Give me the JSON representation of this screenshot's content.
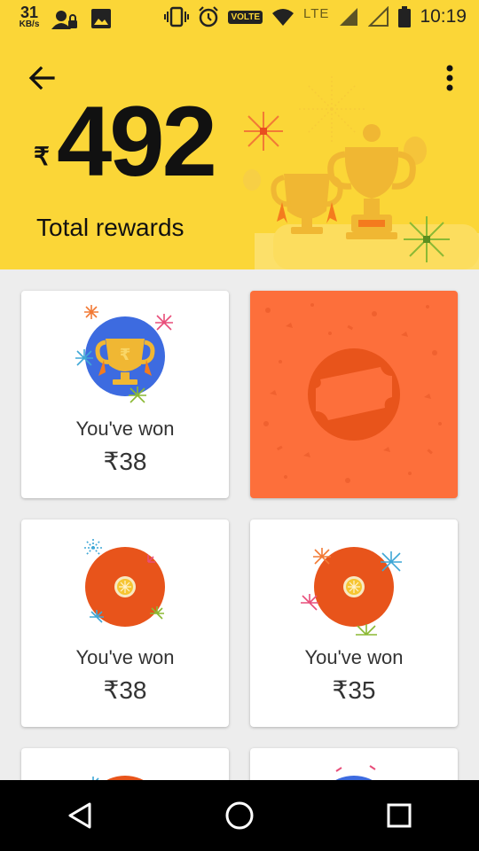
{
  "status_bar": {
    "speed_value": "31",
    "speed_unit": "KB/s",
    "volte": "VOLTE",
    "network": "LTE",
    "time": "10:19"
  },
  "header": {
    "currency_symbol": "₹",
    "total_amount": "492",
    "total_label": "Total rewards"
  },
  "cards": [
    {
      "label": "You've won",
      "value": "₹38",
      "type": "trophy"
    },
    {
      "type": "scratch",
      "state": "unscratched"
    },
    {
      "label": "You've won",
      "value": "₹38",
      "type": "orange"
    },
    {
      "label": "You've won",
      "value": "₹35",
      "type": "orange"
    }
  ],
  "colors": {
    "header_bg": "#fbd637",
    "scratch_card": "#fd6f3b",
    "badge_orange": "#e8541b",
    "badge_blue": "#3d6be0"
  },
  "icons": {
    "back": "arrow-left-icon",
    "menu": "more-vert-icon",
    "nav_back": "triangle-back-icon",
    "nav_home": "circle-home-icon",
    "nav_recents": "square-recents-icon"
  }
}
